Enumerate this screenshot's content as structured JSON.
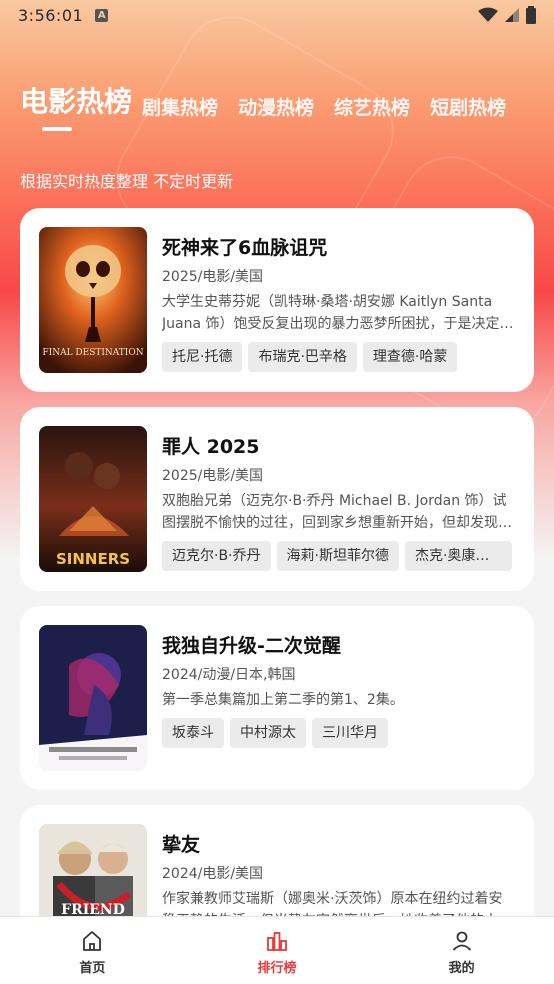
{
  "status": {
    "time": "3:56:01",
    "notif": "A"
  },
  "tabs": [
    "电影热榜",
    "剧集热榜",
    "动漫热榜",
    "综艺热榜",
    "短剧热榜"
  ],
  "subtitle": "根据实时热度整理 不定时更新",
  "items": [
    {
      "title": "死神来了6血脉诅咒",
      "meta": "2025/电影/美国",
      "desc": "大学生史蒂芬妮（凯特琳·桑塔·胡安娜 Kaitlyn Santa Juana 饰）饱受反复出现的暴力恶梦所困扰，于是决定回家寻求答案",
      "cast": [
        "托尼·托德",
        "布瑞克·巴辛格",
        "理查德·哈蒙"
      ],
      "poster_text": "FINAL DESTINATION"
    },
    {
      "title": "罪人 2025",
      "meta": "2025/电影/美国",
      "desc": "双胞胎兄弟（迈克尔·B·乔丹 Michael B. Jordan 饰）试图摆脱不愉快的过往，回到家乡想重新开始，但却发现更邪恶的存在",
      "cast": [
        "迈克尔·B·乔丹",
        "海莉·斯坦菲尔德",
        "杰克·奥康奈尔"
      ],
      "poster_text": "SINNERS"
    },
    {
      "title": "我独自升级-二次觉醒",
      "meta": "2024/动漫/日本,韩国",
      "desc": "第一季总集篇加上第二季的第1、2集。",
      "cast": [
        "坂泰斗",
        "中村源太",
        "三川华月"
      ],
      "poster_text": ""
    },
    {
      "title": "挚友",
      "meta": "2024/电影/美国",
      "desc": "作家兼教师艾瑞斯（娜奥米·沃茨饰）原本在纽约过着安稳平静的生活，但当挚友突然离世后，她收养了他的大丹犬",
      "cast": [],
      "poster_text": "FRIEND"
    }
  ],
  "nav": [
    {
      "label": "首页",
      "icon": "home-icon"
    },
    {
      "label": "排行榜",
      "icon": "chart-icon"
    },
    {
      "label": "我的",
      "icon": "user-icon"
    }
  ],
  "colors": {
    "accent": "#e63a3a"
  }
}
